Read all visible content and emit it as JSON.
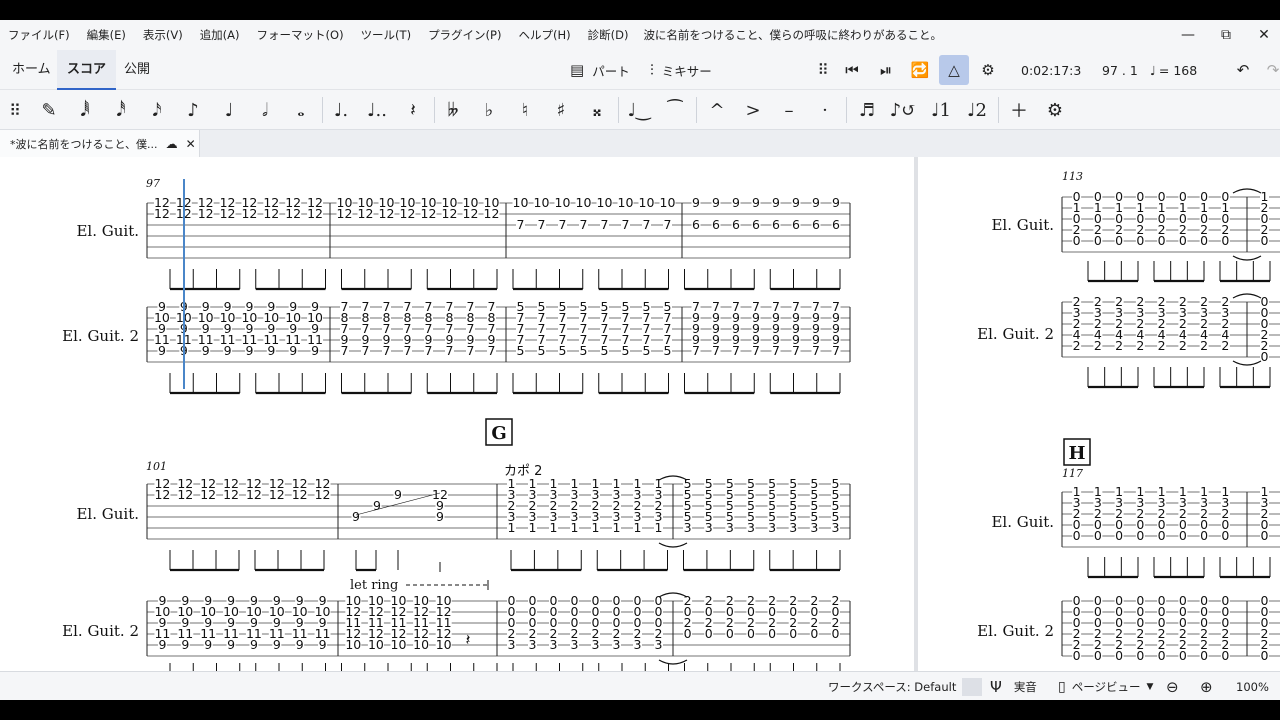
{
  "menu": [
    "ファイル(F)",
    "編集(E)",
    "表示(V)",
    "追加(A)",
    "フォーマット(O)",
    "ツール(T)",
    "プラグイン(P)",
    "ヘルプ(H)",
    "診断(D)"
  ],
  "window_title": "波に名前をつけること、僕らの呼吸に終わりがあること。",
  "window_controls": {
    "minimize": "—",
    "restore": "⧉",
    "close": "✕"
  },
  "modes": {
    "home": "ホーム",
    "score": "スコア",
    "publish": "公開"
  },
  "toolbar": {
    "parts_label": "パート",
    "mixer_label": "ミキサー",
    "time": "0:02:17:3",
    "position": "97 . 1",
    "tempo": "= 168"
  },
  "palette": {
    "note_glyphs": [
      "𝅘𝅥𝅱",
      "𝅘𝅥𝅰",
      "𝅘𝅥𝅯",
      "♪",
      "♩",
      "𝅗𝅥",
      "𝅝",
      "♩.",
      "♩..",
      "𝄽",
      "𝄫",
      "♭",
      "♮",
      "♯",
      "𝄪",
      "ᐩ",
      "^",
      ">",
      "–",
      "·"
    ]
  },
  "document_tab": "*波に名前をつけること、僕...",
  "score": {
    "instrument1": "El. Guit.",
    "instrument2": "El. Guit. 2",
    "measure_numbers": [
      "97",
      "101",
      "113",
      "117"
    ],
    "rehearsal_marks": [
      "G",
      "H"
    ],
    "capo_text": "カポ 2",
    "let_ring_text": "let ring",
    "sys1_guit": [
      {
        "strings": [
          "12",
          "12"
        ],
        "count": 8,
        "wide": true
      },
      {
        "strings": [
          "10",
          "12"
        ],
        "count": 8,
        "wide": true
      },
      {
        "strings": [
          "10",
          "",
          "7"
        ],
        "count": 8,
        "wide": true
      },
      {
        "strings": [
          "9",
          "",
          "6"
        ],
        "count": 8,
        "wide": false
      }
    ],
    "sys1_guit2": [
      {
        "strings": [
          "9",
          "10",
          "9",
          "11",
          "9"
        ],
        "count": 8
      },
      {
        "strings": [
          "7",
          "8",
          "7",
          "9",
          "7"
        ],
        "count": 8
      },
      {
        "strings": [
          "5",
          "7",
          "7",
          "7",
          "5"
        ],
        "count": 8
      },
      {
        "strings": [
          "7",
          "9",
          "9",
          "9",
          "7"
        ],
        "count": 8
      }
    ],
    "sys2_guit": {
      "m101": [
        "12",
        "12"
      ],
      "m102_notes": [
        "9",
        "9",
        "9",
        "12",
        "9",
        "9"
      ],
      "m103": [
        "1",
        "3",
        "2",
        "3",
        "1"
      ],
      "m104": [
        "5",
        "5",
        "5",
        "5",
        "3"
      ]
    },
    "sys2_guit2": {
      "m101": [
        "9",
        "10",
        "9",
        "11",
        "9"
      ],
      "m102": [
        "10",
        "12",
        "11",
        "12",
        "10"
      ],
      "m103": [
        "0",
        "0",
        "0",
        "2",
        "3"
      ],
      "m104": [
        "2",
        "0",
        "2",
        "0",
        ""
      ]
    },
    "right_top_guit": [
      "0",
      "1",
      "0",
      "2",
      "0"
    ],
    "right_top_guit_end": [
      "1",
      "2",
      "0",
      "2",
      "0"
    ],
    "right_top_guit2": [
      "2",
      "3",
      "2",
      "4",
      "2"
    ],
    "right_top_guit2_end": [
      "0",
      "0",
      "0",
      "2",
      "2",
      "0"
    ],
    "right_bottom_guit": [
      "1",
      "3",
      "2",
      "0",
      "0"
    ],
    "right_bottom_guit2": [
      "0",
      "0",
      "0",
      "2",
      "2",
      "0"
    ]
  },
  "status": {
    "workspace": "ワークスペース: Default",
    "concert_pitch": "実音",
    "page_view": "ページビュー",
    "zoom": "100%"
  }
}
